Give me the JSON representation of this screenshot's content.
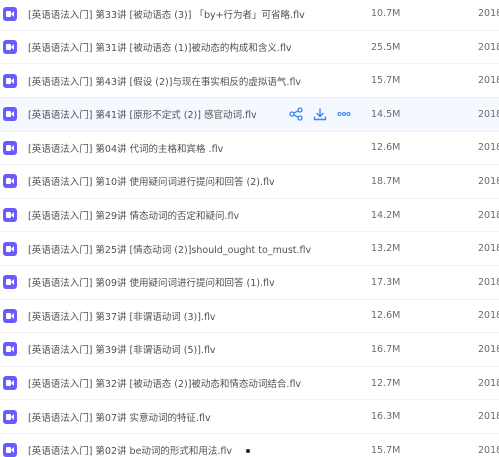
{
  "files": [
    {
      "name": "[英语语法入门] 第33讲 [被动语态 (3)] 「by+行为者」可省略.flv",
      "size": "10.7M",
      "date": "2018-"
    },
    {
      "name": "[英语语法入门] 第31讲 [被动语态 (1)]被动态的构成和含义.flv",
      "size": "25.5M",
      "date": "2018-"
    },
    {
      "name": "[英语语法入门] 第43讲 [假设 (2)]与现在事实相反的虚拟语气.flv",
      "size": "15.7M",
      "date": "2018-"
    },
    {
      "name": "[英语语法入门] 第41讲 [原形不定式 (2)] 感官动词.flv",
      "size": "14.5M",
      "date": "2018-"
    },
    {
      "name": "[英语语法入门] 第04讲 代词的主格和宾格 .flv",
      "size": "12.6M",
      "date": "2018-"
    },
    {
      "name": "[英语语法入门] 第10讲 使用疑问词进行提问和回答 (2).flv",
      "size": "18.7M",
      "date": "2018-"
    },
    {
      "name": "[英语语法入门] 第29讲 情态动词的否定和疑问.flv",
      "size": "14.2M",
      "date": "2018-"
    },
    {
      "name": "[英语语法入门] 第25讲 [情态动词 (2)]should_ought to_must.flv",
      "size": "13.2M",
      "date": "2018-"
    },
    {
      "name": "[英语语法入门] 第09讲 使用疑问词进行提问和回答 (1).flv",
      "size": "17.3M",
      "date": "2018-"
    },
    {
      "name": "[英语语法入门] 第37讲 [非谓语动词 (3)].flv",
      "size": "12.6M",
      "date": "2018-"
    },
    {
      "name": "[英语语法入门] 第39讲 [非谓语动词 (5)].flv",
      "size": "16.7M",
      "date": "2018-"
    },
    {
      "name": "[英语语法入门] 第32讲 [被动语态 (2)]被动态和情态动词结合.flv",
      "size": "12.7M",
      "date": "2018-"
    },
    {
      "name": "[英语语法入门] 第07讲 实意动词的特征.flv",
      "size": "16.3M",
      "date": "2018-"
    },
    {
      "name": "[英语语法入门] 第02讲 be动词的形式和用法.flv",
      "size": "15.7M",
      "date": "2018-"
    }
  ],
  "hovered_row_index": 3,
  "file_icon": "video-file-icon",
  "row_actions": [
    "share-icon",
    "download-icon",
    "more-icon"
  ],
  "colors": {
    "icon": "#6a5bff",
    "action_icon": "#3b82f6",
    "hover_bg": "#f4f8ff",
    "divider": "#f1f1f4"
  }
}
